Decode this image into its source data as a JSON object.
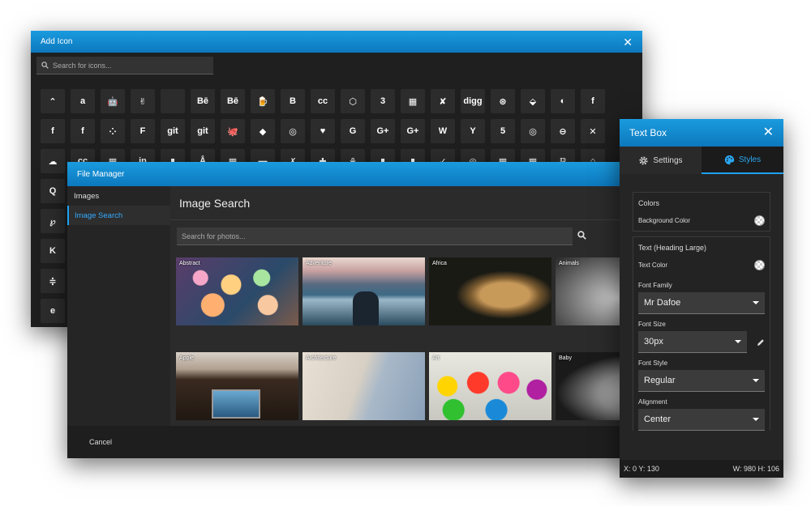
{
  "add_icon": {
    "title": "Add Icon",
    "close": "✕",
    "search_placeholder": "Search for icons...",
    "rows": [
      [
        "⌃",
        "a",
        "🤖",
        "✌",
        "",
        "Bē",
        "Bē",
        "🍺",
        "B",
        "cc",
        "⬡",
        "3",
        "▦",
        "✘",
        "digg",
        "⊛",
        "⬙",
        "◐",
        "f"
      ],
      [
        "f",
        "f",
        "⁘",
        "F",
        "git",
        "git",
        "🐙",
        "◆",
        "◎",
        "♥",
        "G",
        "G+",
        "G+",
        "W",
        "Y",
        "5",
        "◎",
        "⊖",
        "✕"
      ],
      [
        "☁",
        "cc",
        "▦",
        "in",
        "▮",
        "Å",
        "▦",
        "▬",
        "✗",
        "✚",
        "⚘",
        "▮",
        "▮",
        "✓",
        "◎",
        "▦",
        "▦",
        "ℙ",
        "⌂"
      ],
      [
        "Q"
      ],
      [
        "℘"
      ],
      [
        "K"
      ],
      [
        "≑"
      ],
      [
        "e"
      ]
    ]
  },
  "file_manager": {
    "title": "File Manager",
    "sidebar": [
      "Images",
      "Image Search"
    ],
    "heading": "Image Search",
    "search_placeholder": "Search for photos...",
    "photos": [
      "Abstract",
      "Adventure",
      "Africa",
      "Animals",
      "Apple",
      "Architecture",
      "Art",
      "Baby"
    ],
    "cancel_label": "Cancel"
  },
  "text_box": {
    "title": "Text Box",
    "close": "✕",
    "tabs": [
      {
        "label": "Settings"
      },
      {
        "label": "Styles"
      }
    ],
    "colors_title": "Colors",
    "background_color_label": "Background Color",
    "text_title": "Text (Heading Large)",
    "text_color_label": "Text Color",
    "font_family_label": "Font Family",
    "font_family_value": "Mr Dafoe",
    "font_size_label": "Font Size",
    "font_size_value": "30px",
    "font_style_label": "Font Style",
    "font_style_value": "Regular",
    "alignment_label": "Alignment",
    "alignment_value": "Center",
    "status_xy": "X: 0 Y: 130",
    "status_wh": "W: 980 H: 106"
  },
  "colors": {
    "accent": "#1da1f2",
    "titlebar": "#0d78bd"
  }
}
